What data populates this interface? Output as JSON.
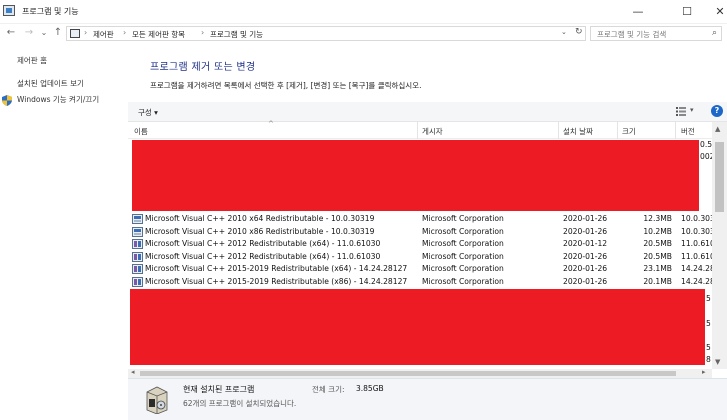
{
  "window": {
    "title": "프로그램 및 기능",
    "minimize": "—",
    "maximize": "☐",
    "close": "✕"
  },
  "nav": {
    "back": "←",
    "forward": "→",
    "recent": "⌄",
    "up": "↑",
    "breadcrumb": [
      "제어판",
      "모든 제어판 항목",
      "프로그램 및 기능"
    ],
    "separator": "›",
    "search_placeholder": "프로그램 및 기능 검색"
  },
  "sidebar": {
    "items": [
      {
        "label": "제어판 홈"
      },
      {
        "label": "설치된 업데이트 보기"
      },
      {
        "label": "Windows 기능 켜기/끄기"
      }
    ]
  },
  "main": {
    "heading": "프로그램 제거 또는 변경",
    "instruction": "프로그램을 제거하려면 목록에서 선택한 후 [제거], [변경] 또는 [복구]를 클릭하십시오."
  },
  "toolbar": {
    "organize_label": "구성 ▾",
    "view_dropdown": "▾",
    "help_label": "?"
  },
  "list": {
    "columns": {
      "name": "이름",
      "publisher": "게시자",
      "installed_on": "설치 날짜",
      "size": "크기",
      "version": "버전"
    },
    "partial_top_versions": [
      "0.5",
      "002"
    ],
    "rows": [
      {
        "name": "Microsoft Visual C++ 2010  x64 Redistributable - 10.0.30319",
        "publisher": "Microsoft Corporation",
        "installed_on": "2020-01-26",
        "size": "12.3MB",
        "version": "10.0.30319"
      },
      {
        "name": "Microsoft Visual C++ 2010  x86 Redistributable - 10.0.30319",
        "publisher": "Microsoft Corporation",
        "installed_on": "2020-01-26",
        "size": "10.2MB",
        "version": "10.0.30319"
      },
      {
        "name": "Microsoft Visual C++ 2012 Redistributable (x64) - 11.0.61030",
        "publisher": "Microsoft Corporation",
        "installed_on": "2020-01-12",
        "size": "20.5MB",
        "version": "11.0.61030"
      },
      {
        "name": "Microsoft Visual C++ 2012 Redistributable (x64) - 11.0.61030",
        "publisher": "Microsoft Corporation",
        "installed_on": "2020-01-26",
        "size": "20.5MB",
        "version": "11.0.61030"
      },
      {
        "name": "Microsoft Visual C++ 2015-2019 Redistributable (x64) - 14.24.28127",
        "publisher": "Microsoft Corporation",
        "installed_on": "2020-01-26",
        "size": "23.1MB",
        "version": "14.24.2812"
      },
      {
        "name": "Microsoft Visual C++ 2015-2019 Redistributable (x86) - 14.24.28127",
        "publisher": "Microsoft Corporation",
        "installed_on": "2020-01-26",
        "size": "20.1MB",
        "version": "14.24.2812"
      }
    ],
    "partial_bottom_versions": [
      "5",
      "5",
      "5",
      "8"
    ]
  },
  "details": {
    "title": "현재 설치된 프로그램",
    "total_size_label": "전체 크기:",
    "total_size_value": "3.85GB",
    "count_text": "62개의 프로그램이 설치되었습니다."
  },
  "colors": {
    "heading": "#1e3287",
    "redaction": "#ed1c24",
    "help": "#1d67c9"
  },
  "icons": {
    "app": "control-panel-icon",
    "shield": "uac-shield-icon",
    "program": "installer-icon",
    "details": "software-box-icon"
  }
}
